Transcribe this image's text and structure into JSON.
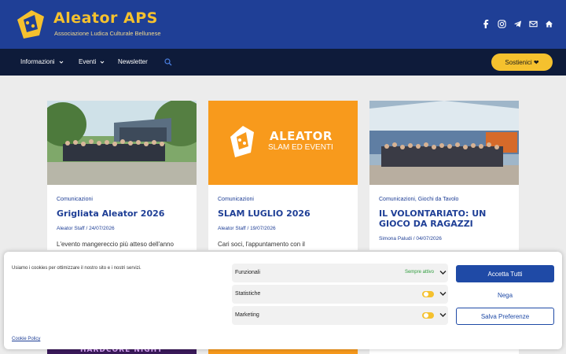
{
  "header": {
    "title": "Aleator APS",
    "subtitle": "Associazione Ludica Culturale Bellunese",
    "socials": [
      "facebook-icon",
      "instagram-icon",
      "telegram-icon",
      "email-icon",
      "home-icon"
    ]
  },
  "nav": {
    "items": [
      {
        "label": "Informazioni",
        "has_dropdown": true
      },
      {
        "label": "Eventi",
        "has_dropdown": true
      },
      {
        "label": "Newsletter",
        "has_dropdown": false
      }
    ],
    "support_label": "Sostienici ❤"
  },
  "posts": [
    {
      "image": "group-photo-outdoor",
      "categories": "Comunicazioni",
      "title": "Grigliata Aleator 2026",
      "meta": "Aleator Staff / 24/07/2026",
      "excerpt": "L'evento mangereccio più atteso dell'anno"
    },
    {
      "image_text_1": "ALEATOR",
      "image_text_2": "SLAM ED EVENTI",
      "categories": "Comunicazioni",
      "title": "SLAM LUGLIO 2026",
      "meta": "Aleator Staff / 19/07/2026",
      "excerpt": "Cari soci, l'appuntamento con il"
    },
    {
      "image": "group-photo-tent",
      "categories": "Comunicazioni, Giochi da Tavolo",
      "title_line1": "IL VOLONTARIATO: UN",
      "title_line2": "GIOCO DA RAGAZZI",
      "meta": "Simona Paludi / 04/07/2026",
      "excerpt": ""
    }
  ],
  "bottom_cards": {
    "first_text": "HARDCORE NIGHT"
  },
  "cookie_banner": {
    "message": "Usiamo i cookies per ottimizzare il nostro sito e i nostri servizi.",
    "policy_link": "Cookie Policy",
    "categories": [
      {
        "label": "Funzionali",
        "status": "Sempre attivo"
      },
      {
        "label": "Statistiche",
        "status": ""
      },
      {
        "label": "Marketing",
        "status": ""
      }
    ],
    "accept_label": "Accetta Tutti",
    "deny_label": "Nega",
    "save_label": "Salva Preferenze"
  },
  "colors": {
    "brand_blue": "#1f3f96",
    "nav_dark": "#0e1b3a",
    "accent_yellow": "#f5c12e",
    "orange": "#f89a1c"
  }
}
